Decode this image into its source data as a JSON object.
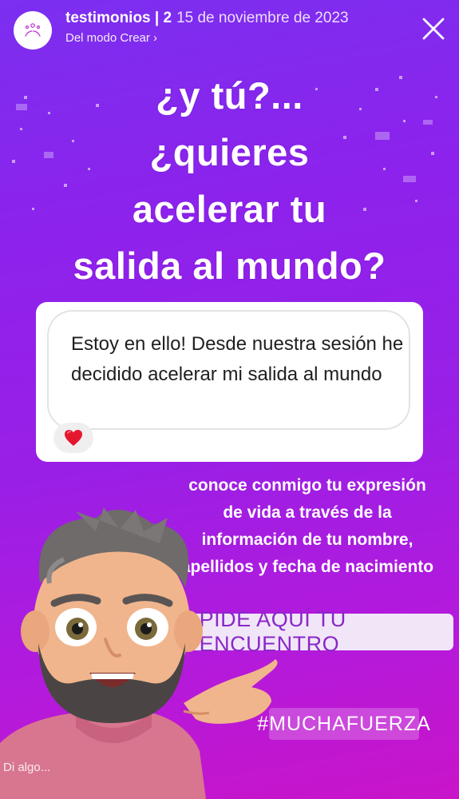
{
  "header": {
    "account_name": "testimonios | 2",
    "date": "15 de noviembre de 2023",
    "source_label": "Del modo Crear ›",
    "avatar_icon": "hands-sparkle-icon",
    "close_icon": "close-icon"
  },
  "story": {
    "headline_lines": [
      "¿y tú?...",
      "¿quieres",
      "acelerar tu",
      "salida al mundo?"
    ],
    "reply_text": "Estoy en ello! Desde nuestra sesión he decidido acelerar mi salida al mundo",
    "reaction": "❤️",
    "cta_text": "conoce conmigo tu expresión de vida a través de la información de tu nombre, apellidos y fecha de nacimiento",
    "link_label": "PIDE AQUÍ TU ENCUENTRO",
    "link_icon": "link-icon",
    "hashtag": "#MUCHAFUERZA"
  },
  "footer": {
    "reply_placeholder": "Di algo..."
  },
  "colors": {
    "background_top": "#7b2ff0",
    "background_bottom": "#c914c9",
    "link_text": "#8a27c9"
  }
}
